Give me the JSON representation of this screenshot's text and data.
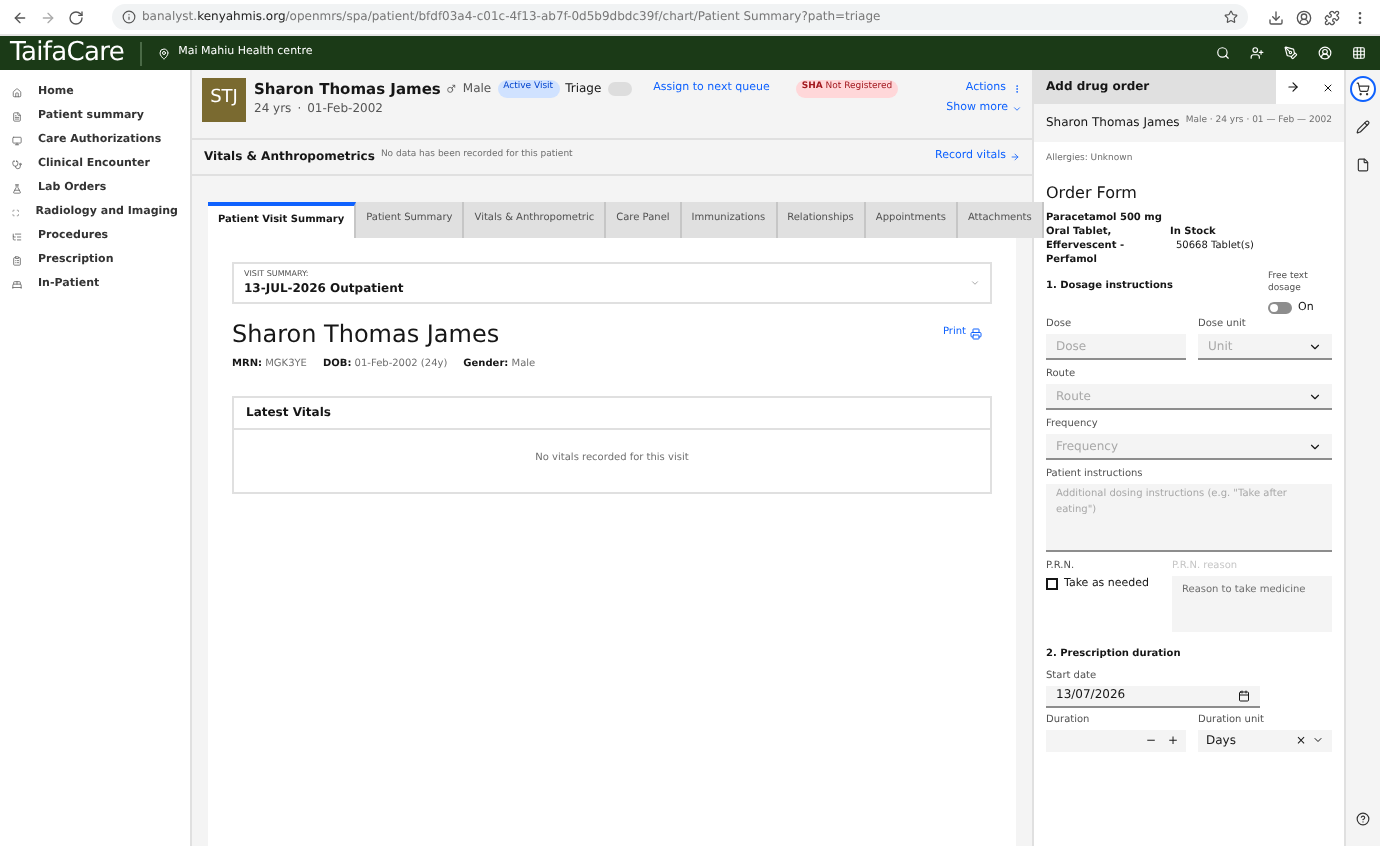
{
  "browser": {
    "url": "banalyst.**kenyahmis.org**/openmrs/spa/patient/bfdf03a4-c01c-4f13-ab7f-0d5b9dbdc39f/chart/Patient Summary?path=triage"
  },
  "header": {
    "logo": "TaifaCare",
    "location": "Mai Mahiu Health centre"
  },
  "sidebar": {
    "items": [
      {
        "label": "Home"
      },
      {
        "label": "Patient summary"
      },
      {
        "label": "Care Authorizations"
      },
      {
        "label": "Clinical Encounter"
      },
      {
        "label": "Lab Orders"
      },
      {
        "label": "Radiology and Imaging"
      },
      {
        "label": "Procedures"
      },
      {
        "label": "Prescription"
      },
      {
        "label": "In-Patient"
      }
    ]
  },
  "patient_banner": {
    "initials": "STJ",
    "name": "Sharon Thomas James",
    "gender": "Male",
    "visit_badge": "Active Visit",
    "triage": "Triage",
    "assign": "Assign to next queue",
    "sha_label": "SHA",
    "sha_status": "Not Registered",
    "age": "24 yrs",
    "separator": "·",
    "dob": "01-Feb-2002",
    "actions": "Actions",
    "show_more": "Show more"
  },
  "vitals_bar": {
    "title": "Vitals & Anthropometrics",
    "note": "No data has been recorded for this patient",
    "action": "Record vitals"
  },
  "tabs": [
    {
      "label": "Patient Visit Summary",
      "selected": true
    },
    {
      "label": "Patient Summary",
      "selected": false
    },
    {
      "label": "Vitals & Anthropometric",
      "selected": false
    },
    {
      "label": "Care Panel",
      "selected": false
    },
    {
      "label": "Immunizations",
      "selected": false
    },
    {
      "label": "Relationships",
      "selected": false
    },
    {
      "label": "Appointments",
      "selected": false
    },
    {
      "label": "Attachments",
      "selected": false
    }
  ],
  "visit_summary": {
    "label": "VISIT SUMMARY:",
    "value": "13-JUL-2026 Outpatient",
    "patient_name": "Sharon Thomas James",
    "print": "Print",
    "details": [
      {
        "label": "MRN:",
        "value": "MGK3YE"
      },
      {
        "label": "DOB:",
        "value": "01-Feb-2002 (24y)"
      },
      {
        "label": "Gender:",
        "value": "Male"
      }
    ],
    "latest_vitals": {
      "title": "Latest Vitals",
      "empty": "No vitals recorded for this visit"
    }
  },
  "drug_order": {
    "title": "Add drug order",
    "patient_name": "Sharon Thomas James",
    "patient_meta": "Male · 24 yrs · 01 — Feb — 2002",
    "allergies": "Allergies: Unknown",
    "form_title": "Order Form",
    "drug": "Paracetamol 500 mg Oral Tablet, Effervescent - Perfamol",
    "stock": "In Stock",
    "quantity": "50668 Tablet(s)",
    "dosage": {
      "title": "1. Dosage instructions",
      "free_text_label": "Free text dosage",
      "free_text_toggle": {
        "on": false,
        "label": "On"
      },
      "dose": {
        "label": "Dose",
        "placeholder": "Dose"
      },
      "dose_unit": {
        "label": "Dose unit",
        "placeholder": "Unit"
      },
      "route": {
        "label": "Route",
        "placeholder": "Route"
      },
      "frequency": {
        "label": "Frequency",
        "placeholder": "Frequency"
      },
      "instructions": {
        "label": "Patient instructions",
        "placeholder": "Additional dosing instructions (e.g. \"Take after eating\")"
      },
      "prn": {
        "label": "P.R.N.",
        "checkbox": "Take as needed",
        "checked": false
      },
      "prn_reason": {
        "label": "P.R.N. reason",
        "placeholder": "Reason to take medicine"
      }
    },
    "duration": {
      "title": "2. Prescription duration",
      "start_date": {
        "label": "Start date",
        "value": "13/07/2026"
      },
      "duration": {
        "label": "Duration",
        "minus": "−",
        "plus": "+"
      },
      "duration_unit": {
        "label": "Duration unit",
        "value": "Days",
        "clear": "×"
      }
    }
  },
  "right_rail": [
    {
      "kind": "cart",
      "selected": true
    },
    {
      "kind": "pen",
      "selected": false
    },
    {
      "kind": "document",
      "selected": false
    }
  ]
}
